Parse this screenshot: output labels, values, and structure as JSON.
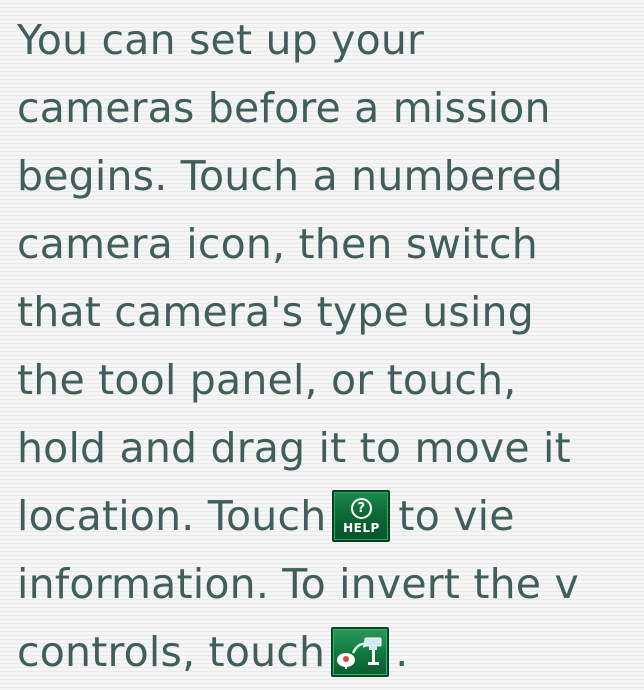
{
  "manual": {
    "lines": [
      "You can set up your",
      "cameras before a mission",
      "begins. Touch a numbered",
      "camera icon, then switch",
      "that camera's type using",
      "the tool panel, or touch,",
      "hold and drag it to move it",
      "location. Touch",
      "to vie",
      "information. To invert the v",
      "controls, touch",
      "."
    ],
    "help_icon_label": "HELP",
    "help_icon_glyph": "?"
  },
  "colors": {
    "text": "#3f5e5c",
    "background": "#f3f4f3",
    "icon_green": "#0d6a35"
  },
  "icons": {
    "help": "help-button-icon",
    "invert": "camera-invert-controls-icon"
  }
}
